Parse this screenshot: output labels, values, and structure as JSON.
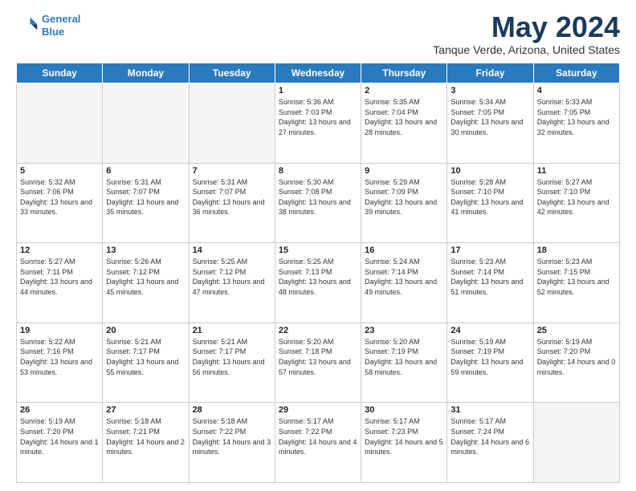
{
  "header": {
    "logo_line1": "General",
    "logo_line2": "Blue",
    "month": "May 2024",
    "location": "Tanque Verde, Arizona, United States"
  },
  "weekdays": [
    "Sunday",
    "Monday",
    "Tuesday",
    "Wednesday",
    "Thursday",
    "Friday",
    "Saturday"
  ],
  "weeks": [
    [
      {
        "day": "",
        "info": ""
      },
      {
        "day": "",
        "info": ""
      },
      {
        "day": "",
        "info": ""
      },
      {
        "day": "1",
        "info": "Sunrise: 5:36 AM\nSunset: 7:03 PM\nDaylight: 13 hours\nand 27 minutes."
      },
      {
        "day": "2",
        "info": "Sunrise: 5:35 AM\nSunset: 7:04 PM\nDaylight: 13 hours\nand 28 minutes."
      },
      {
        "day": "3",
        "info": "Sunrise: 5:34 AM\nSunset: 7:05 PM\nDaylight: 13 hours\nand 30 minutes."
      },
      {
        "day": "4",
        "info": "Sunrise: 5:33 AM\nSunset: 7:05 PM\nDaylight: 13 hours\nand 32 minutes."
      }
    ],
    [
      {
        "day": "5",
        "info": "Sunrise: 5:32 AM\nSunset: 7:06 PM\nDaylight: 13 hours\nand 33 minutes."
      },
      {
        "day": "6",
        "info": "Sunrise: 5:31 AM\nSunset: 7:07 PM\nDaylight: 13 hours\nand 35 minutes."
      },
      {
        "day": "7",
        "info": "Sunrise: 5:31 AM\nSunset: 7:07 PM\nDaylight: 13 hours\nand 36 minutes."
      },
      {
        "day": "8",
        "info": "Sunrise: 5:30 AM\nSunset: 7:08 PM\nDaylight: 13 hours\nand 38 minutes."
      },
      {
        "day": "9",
        "info": "Sunrise: 5:29 AM\nSunset: 7:09 PM\nDaylight: 13 hours\nand 39 minutes."
      },
      {
        "day": "10",
        "info": "Sunrise: 5:28 AM\nSunset: 7:10 PM\nDaylight: 13 hours\nand 41 minutes."
      },
      {
        "day": "11",
        "info": "Sunrise: 5:27 AM\nSunset: 7:10 PM\nDaylight: 13 hours\nand 42 minutes."
      }
    ],
    [
      {
        "day": "12",
        "info": "Sunrise: 5:27 AM\nSunset: 7:11 PM\nDaylight: 13 hours\nand 44 minutes."
      },
      {
        "day": "13",
        "info": "Sunrise: 5:26 AM\nSunset: 7:12 PM\nDaylight: 13 hours\nand 45 minutes."
      },
      {
        "day": "14",
        "info": "Sunrise: 5:25 AM\nSunset: 7:12 PM\nDaylight: 13 hours\nand 47 minutes."
      },
      {
        "day": "15",
        "info": "Sunrise: 5:25 AM\nSunset: 7:13 PM\nDaylight: 13 hours\nand 48 minutes."
      },
      {
        "day": "16",
        "info": "Sunrise: 5:24 AM\nSunset: 7:14 PM\nDaylight: 13 hours\nand 49 minutes."
      },
      {
        "day": "17",
        "info": "Sunrise: 5:23 AM\nSunset: 7:14 PM\nDaylight: 13 hours\nand 51 minutes."
      },
      {
        "day": "18",
        "info": "Sunrise: 5:23 AM\nSunset: 7:15 PM\nDaylight: 13 hours\nand 52 minutes."
      }
    ],
    [
      {
        "day": "19",
        "info": "Sunrise: 5:22 AM\nSunset: 7:16 PM\nDaylight: 13 hours\nand 53 minutes."
      },
      {
        "day": "20",
        "info": "Sunrise: 5:21 AM\nSunset: 7:17 PM\nDaylight: 13 hours\nand 55 minutes."
      },
      {
        "day": "21",
        "info": "Sunrise: 5:21 AM\nSunset: 7:17 PM\nDaylight: 13 hours\nand 56 minutes."
      },
      {
        "day": "22",
        "info": "Sunrise: 5:20 AM\nSunset: 7:18 PM\nDaylight: 13 hours\nand 57 minutes."
      },
      {
        "day": "23",
        "info": "Sunrise: 5:20 AM\nSunset: 7:19 PM\nDaylight: 13 hours\nand 58 minutes."
      },
      {
        "day": "24",
        "info": "Sunrise: 5:19 AM\nSunset: 7:19 PM\nDaylight: 13 hours\nand 59 minutes."
      },
      {
        "day": "25",
        "info": "Sunrise: 5:19 AM\nSunset: 7:20 PM\nDaylight: 14 hours\nand 0 minutes."
      }
    ],
    [
      {
        "day": "26",
        "info": "Sunrise: 5:19 AM\nSunset: 7:20 PM\nDaylight: 14 hours\nand 1 minute."
      },
      {
        "day": "27",
        "info": "Sunrise: 5:18 AM\nSunset: 7:21 PM\nDaylight: 14 hours\nand 2 minutes."
      },
      {
        "day": "28",
        "info": "Sunrise: 5:18 AM\nSunset: 7:22 PM\nDaylight: 14 hours\nand 3 minutes."
      },
      {
        "day": "29",
        "info": "Sunrise: 5:17 AM\nSunset: 7:22 PM\nDaylight: 14 hours\nand 4 minutes."
      },
      {
        "day": "30",
        "info": "Sunrise: 5:17 AM\nSunset: 7:23 PM\nDaylight: 14 hours\nand 5 minutes."
      },
      {
        "day": "31",
        "info": "Sunrise: 5:17 AM\nSunset: 7:24 PM\nDaylight: 14 hours\nand 6 minutes."
      },
      {
        "day": "",
        "info": ""
      }
    ]
  ]
}
